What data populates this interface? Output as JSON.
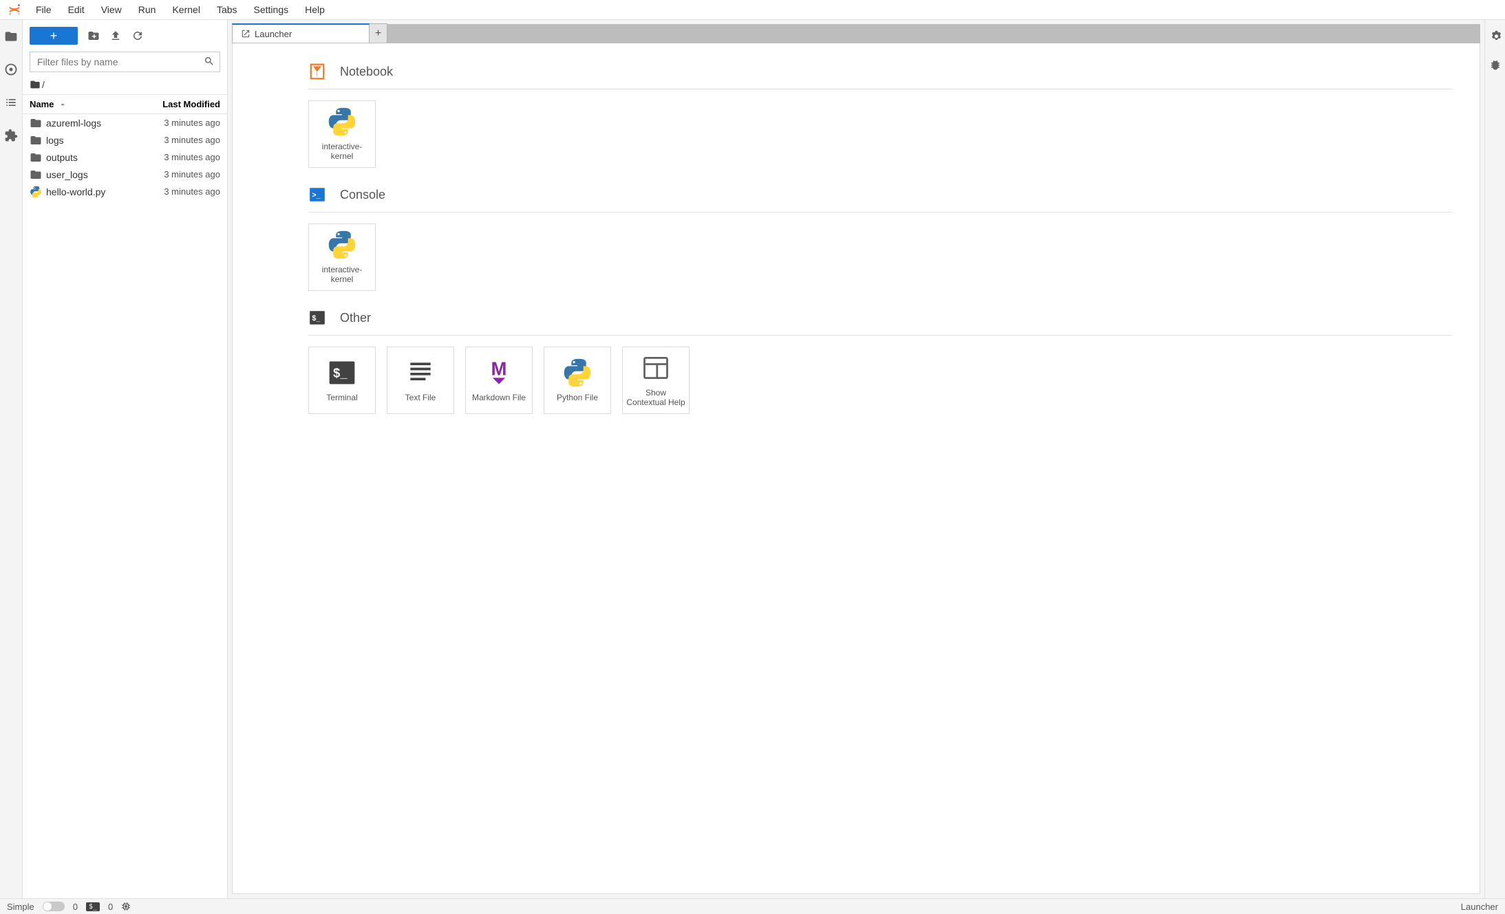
{
  "menu": {
    "items": [
      "File",
      "Edit",
      "View",
      "Run",
      "Kernel",
      "Tabs",
      "Settings",
      "Help"
    ]
  },
  "file_toolbar": {
    "filter_placeholder": "Filter files by name"
  },
  "breadcrumb": {
    "root": "/"
  },
  "file_header": {
    "name": "Name",
    "modified": "Last Modified"
  },
  "files": [
    {
      "name": "azureml-logs",
      "type": "folder",
      "modified": "3 minutes ago"
    },
    {
      "name": "logs",
      "type": "folder",
      "modified": "3 minutes ago"
    },
    {
      "name": "outputs",
      "type": "folder",
      "modified": "3 minutes ago"
    },
    {
      "name": "user_logs",
      "type": "folder",
      "modified": "3 minutes ago"
    },
    {
      "name": "hello-world.py",
      "type": "python",
      "modified": "3 minutes ago"
    }
  ],
  "tab": {
    "title": "Launcher"
  },
  "launcher": {
    "notebook_label": "Notebook",
    "console_label": "Console",
    "other_label": "Other",
    "notebook_cards": [
      {
        "label": "interactive-kernel"
      }
    ],
    "console_cards": [
      {
        "label": "interactive-kernel"
      }
    ],
    "other_cards": [
      {
        "label": "Terminal",
        "icon": "terminal"
      },
      {
        "label": "Text File",
        "icon": "text"
      },
      {
        "label": "Markdown File",
        "icon": "markdown"
      },
      {
        "label": "Python File",
        "icon": "python"
      },
      {
        "label": "Show Contextual Help",
        "icon": "help"
      }
    ]
  },
  "statusbar": {
    "simple_label": "Simple",
    "terminals": "0",
    "kernels": "0",
    "right": "Launcher"
  },
  "colors": {
    "accent": "#1976d2",
    "orange": "#f37726",
    "purple": "#8e24aa"
  }
}
